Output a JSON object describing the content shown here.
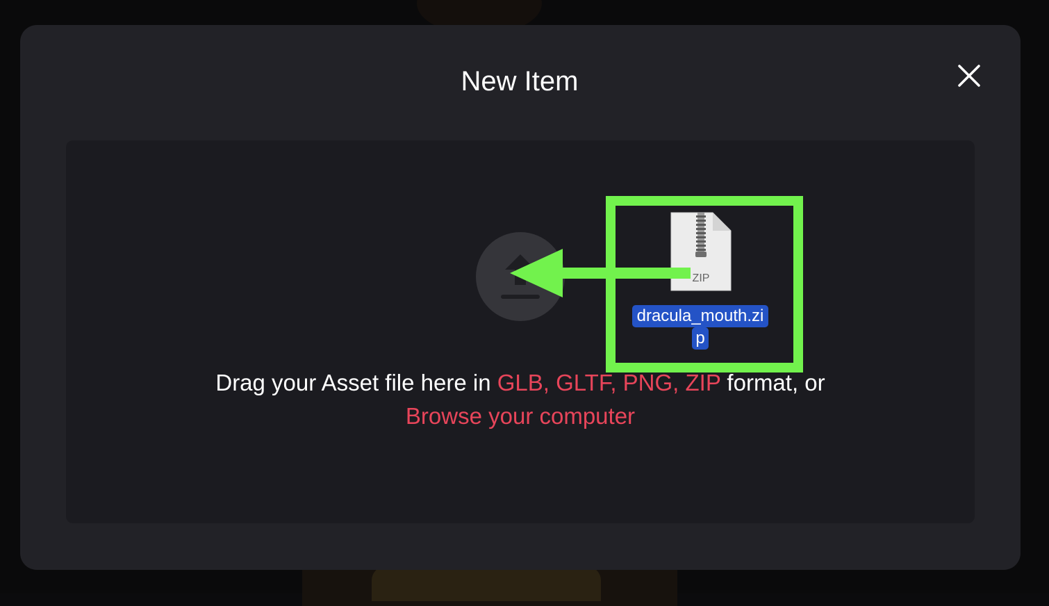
{
  "modal": {
    "title": "New Item"
  },
  "dropzone": {
    "text_prefix": "Drag your Asset file here in ",
    "formats": "GLB, GLTF, PNG, ZIP",
    "text_suffix": " format, or",
    "browse_label": "Browse your computer"
  },
  "dragged_file": {
    "name_line1": "dracula_mouth.zi",
    "name_line2": "p",
    "type_badge": "ZIP"
  },
  "icons": {
    "close": "close-icon",
    "upload": "upload-icon",
    "file": "zip-file-icon",
    "arrow": "arrow-left-icon"
  },
  "colors": {
    "accent": "#e8455a",
    "highlight": "#72f24d",
    "selection": "#2453c6",
    "modal_bg": "#222227",
    "dropzone_bg": "#1b1b20"
  }
}
